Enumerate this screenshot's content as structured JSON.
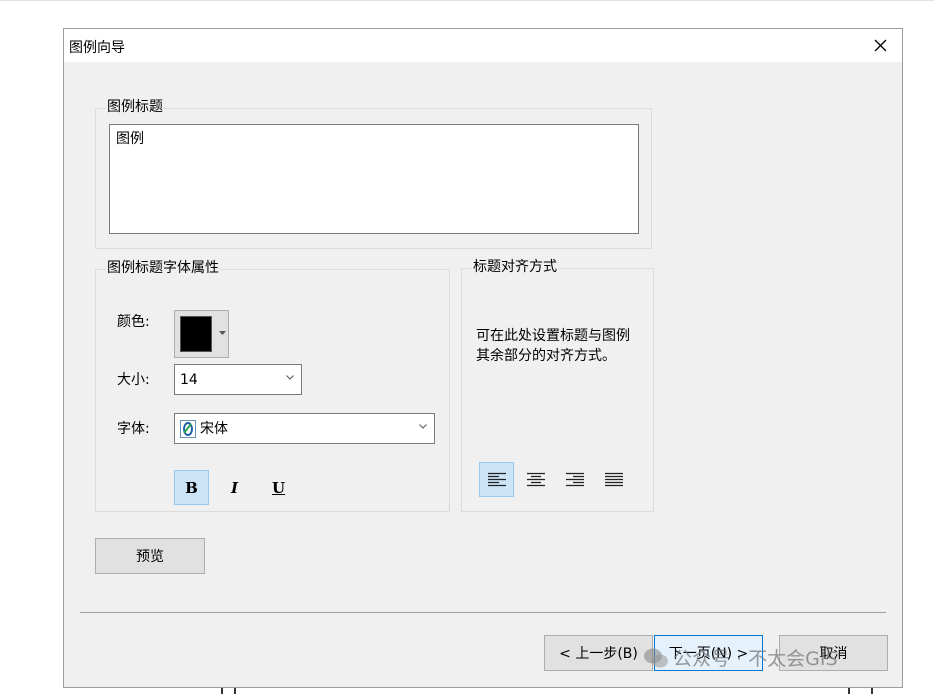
{
  "dialog": {
    "title": "图例向导"
  },
  "legend_title_group": {
    "label": "图例标题",
    "text_value": "图例"
  },
  "font_group": {
    "label": "图例标题字体属性",
    "color_label": "颜色:",
    "color_value": "#000000",
    "size_label": "大小:",
    "size_value": "14",
    "font_label": "字体:",
    "font_value": "宋体",
    "bold_label": "B",
    "italic_label": "I",
    "underline_label": "U",
    "bold_active": true
  },
  "align_group": {
    "label": "标题对齐方式",
    "description": "可在此处设置标题与图例其余部分的对齐方式。",
    "selected": "left"
  },
  "preview_button": "预览",
  "footer": {
    "back_button": "< 上一步(B)",
    "next_button": "下一页(N) >",
    "cancel_button": "取消"
  },
  "watermark": "公众号 · 不太会GIS",
  "colors": {
    "dialog_bg": "#f0f0f0",
    "selection_bg": "#cce4f7",
    "focus_border": "#0078d7"
  }
}
